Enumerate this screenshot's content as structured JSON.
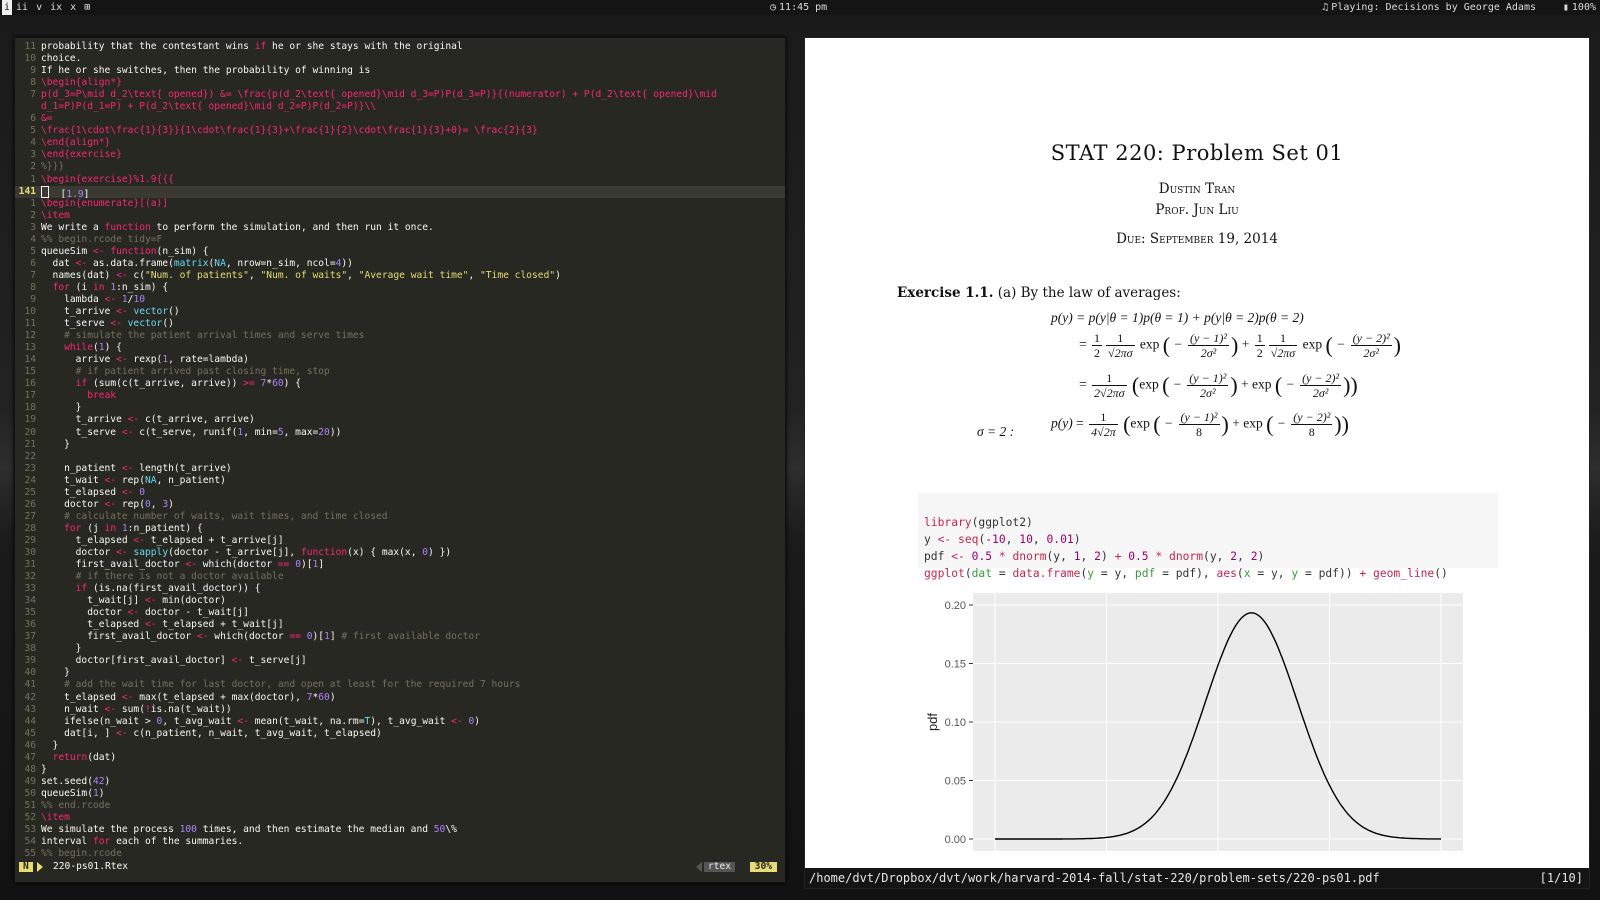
{
  "topbar": {
    "workspaces": [
      "i",
      "ii",
      "v",
      "ix",
      "x",
      "⊞"
    ],
    "active_workspace": 0,
    "time": "11:45 pm",
    "now_playing": "Playing: Decisions by George Adams",
    "battery": "100%"
  },
  "editor": {
    "lines": [
      {
        "n": "11",
        "t": "probability that the contestant wins if he or she stays with the original",
        "cls": ""
      },
      {
        "n": "10",
        "t": "choice.",
        "cls": ""
      },
      {
        "n": "9",
        "t": "If he or she switches, then the probability of winning is",
        "cls": ""
      },
      {
        "n": "8",
        "t": "\\begin{align*}",
        "cls": "k"
      },
      {
        "n": "7",
        "t": "p(d_3=P\\mid d_2\\text{ opened}) &= \\frac{p(d_2\\text{ opened}\\mid d_3=P)P(d_3=P)}{(numerator) + P(d_2\\text{ opened}\\mid",
        "cls": "k"
      },
      {
        "n": "",
        "t": "d_1=P)P(d_1=P) + P(d_2\\text{ opened}\\mid d_2=P)P(d_2=P)}\\\\",
        "cls": "k"
      },
      {
        "n": "6",
        "t": "&=",
        "cls": "k"
      },
      {
        "n": "5",
        "t": "\\frac{1\\cdot\\frac{1}{3}}{1\\cdot\\frac{1}{3}+\\frac{1}{2}\\cdot\\frac{1}{3}+0}= \\frac{2}{3}",
        "cls": "k"
      },
      {
        "n": "4",
        "t": "\\end{align*}",
        "cls": "k"
      },
      {
        "n": "3",
        "t": "\\end{exercise}",
        "cls": "k"
      },
      {
        "n": "2",
        "t": "%}}}",
        "cls": "c"
      },
      {
        "n": "1",
        "t": "\\begin{exercise}%1.9{{{",
        "cls": "k"
      },
      {
        "n": "141",
        "t": "  [1.9]",
        "cls": "",
        "cur": true
      },
      {
        "n": "1",
        "t": "\\begin{enumerate}[(a)]",
        "cls": "k"
      },
      {
        "n": "2",
        "t": "\\item",
        "cls": "k"
      },
      {
        "n": "3",
        "t": "We write a function to perform the simulation, and then run it once.",
        "cls": ""
      },
      {
        "n": "4",
        "t": "%% begin.rcode tidy=F",
        "cls": "c"
      },
      {
        "n": "5",
        "t": "queueSim <- function(n_sim) {",
        "cls": ""
      },
      {
        "n": "6",
        "t": "  dat <- as.data.frame(matrix(NA, nrow=n_sim, ncol=4))",
        "cls": ""
      },
      {
        "n": "7",
        "t": "  names(dat) <- c(\"Num. of patients\", \"Num. of waits\", \"Average wait time\", \"Time closed\")",
        "cls": ""
      },
      {
        "n": "8",
        "t": "  for (i in 1:n_sim) {",
        "cls": ""
      },
      {
        "n": "9",
        "t": "    lambda <- 1/10",
        "cls": ""
      },
      {
        "n": "10",
        "t": "    t_arrive <- vector()",
        "cls": ""
      },
      {
        "n": "11",
        "t": "    t_serve <- vector()",
        "cls": ""
      },
      {
        "n": "12",
        "t": "    # simulate the patient arrival times and serve times",
        "cls": "c"
      },
      {
        "n": "13",
        "t": "    while(1) {",
        "cls": ""
      },
      {
        "n": "14",
        "t": "      arrive <- rexp(1, rate=lambda)",
        "cls": ""
      },
      {
        "n": "15",
        "t": "      # if patient arrived past closing time, stop",
        "cls": "c"
      },
      {
        "n": "16",
        "t": "      if (sum(c(t_arrive, arrive)) >= 7*60) {",
        "cls": ""
      },
      {
        "n": "17",
        "t": "        break",
        "cls": "k"
      },
      {
        "n": "18",
        "t": "      }",
        "cls": ""
      },
      {
        "n": "19",
        "t": "      t_arrive <- c(t_arrive, arrive)",
        "cls": ""
      },
      {
        "n": "20",
        "t": "      t_serve <- c(t_serve, runif(1, min=5, max=20))",
        "cls": ""
      },
      {
        "n": "21",
        "t": "    }",
        "cls": ""
      },
      {
        "n": "22",
        "t": "",
        "cls": ""
      },
      {
        "n": "23",
        "t": "    n_patient <- length(t_arrive)",
        "cls": ""
      },
      {
        "n": "24",
        "t": "    t_wait <- rep(NA, n_patient)",
        "cls": ""
      },
      {
        "n": "25",
        "t": "    t_elapsed <- 0",
        "cls": ""
      },
      {
        "n": "26",
        "t": "    doctor <- rep(0, 3)",
        "cls": ""
      },
      {
        "n": "27",
        "t": "    # calculate number of waits, wait times, and time closed",
        "cls": "c"
      },
      {
        "n": "28",
        "t": "    for (j in 1:n_patient) {",
        "cls": ""
      },
      {
        "n": "29",
        "t": "      t_elapsed <- t_elapsed + t_arrive[j]",
        "cls": ""
      },
      {
        "n": "30",
        "t": "      doctor <- sapply(doctor - t_arrive[j], function(x) { max(x, 0) })",
        "cls": ""
      },
      {
        "n": "31",
        "t": "      first_avail_doctor <- which(doctor == 0)[1]",
        "cls": ""
      },
      {
        "n": "32",
        "t": "      # if there is not a doctor available",
        "cls": "c"
      },
      {
        "n": "33",
        "t": "      if (is.na(first_avail_doctor)) {",
        "cls": ""
      },
      {
        "n": "34",
        "t": "        t_wait[j] <- min(doctor)",
        "cls": ""
      },
      {
        "n": "35",
        "t": "        doctor <- doctor - t_wait[j]",
        "cls": ""
      },
      {
        "n": "36",
        "t": "        t_elapsed <- t_elapsed + t_wait[j]",
        "cls": ""
      },
      {
        "n": "37",
        "t": "        first_avail_doctor <- which(doctor == 0)[1] # first available doctor",
        "cls": ""
      },
      {
        "n": "38",
        "t": "      }",
        "cls": ""
      },
      {
        "n": "39",
        "t": "      doctor[first_avail_doctor] <- t_serve[j]",
        "cls": ""
      },
      {
        "n": "40",
        "t": "    }",
        "cls": ""
      },
      {
        "n": "41",
        "t": "    # add the wait time for last doctor, and open at least for the required 7 hours",
        "cls": "c"
      },
      {
        "n": "42",
        "t": "    t_elapsed <- max(t_elapsed + max(doctor), 7*60)",
        "cls": ""
      },
      {
        "n": "43",
        "t": "    n_wait <- sum(!is.na(t_wait))",
        "cls": ""
      },
      {
        "n": "44",
        "t": "    ifelse(n_wait > 0, t_avg_wait <- mean(t_wait, na.rm=T), t_avg_wait <- 0)",
        "cls": ""
      },
      {
        "n": "45",
        "t": "    dat[i, ] <- c(n_patient, n_wait, t_avg_wait, t_elapsed)",
        "cls": ""
      },
      {
        "n": "46",
        "t": "  }",
        "cls": ""
      },
      {
        "n": "47",
        "t": "  return(dat)",
        "cls": ""
      },
      {
        "n": "48",
        "t": "}",
        "cls": ""
      },
      {
        "n": "49",
        "t": "set.seed(42)",
        "cls": ""
      },
      {
        "n": "50",
        "t": "queueSim(1)",
        "cls": ""
      },
      {
        "n": "51",
        "t": "%% end.rcode",
        "cls": "c"
      },
      {
        "n": "52",
        "t": "\\item",
        "cls": "k"
      },
      {
        "n": "53",
        "t": "We simulate the process 100 times, and then estimate the median and 50\\%",
        "cls": ""
      },
      {
        "n": "54",
        "t": "interval for each of the summaries.",
        "cls": ""
      },
      {
        "n": "55",
        "t": "%% begin.rcode",
        "cls": "c"
      }
    ],
    "status": {
      "mode": "N",
      "filename": "220-ps01.Rtex",
      "filetype": "rtex",
      "percent": "30%"
    }
  },
  "viewer": {
    "title": "STAT 220: Problem Set 01",
    "author1": "Dustin Tran",
    "author2": "Prof. Jun Liu",
    "due": "Due: September 19, 2014",
    "exercise_label": "Exercise 1.1.",
    "exercise_text": "(a)  By the law of averages:",
    "sigma_label": "σ = 2 :",
    "rcode_lines": [
      "library(ggplot2)",
      "y <- seq(-10, 10, 0.01)",
      "pdf <- 0.5 * dnorm(y, 1, 2) + 0.5 * dnorm(y, 2, 2)",
      "ggplot(dat = data.frame(y = y, pdf = pdf), aes(x = y, y = pdf)) + geom_line()"
    ],
    "path": "/home/dvt/Dropbox/dvt/work/harvard-2014-fall/stat-220/problem-sets/220-ps01.pdf",
    "page_indicator": "[1/10]"
  },
  "chart_data": {
    "type": "line",
    "ylabel": "pdf",
    "ylim": [
      0,
      0.2
    ],
    "xlim": [
      -10,
      10
    ],
    "yticks": [
      "0.00",
      "0.05",
      "0.10",
      "0.15",
      "0.20"
    ],
    "series": [
      {
        "formula": "0.5*dnorm(y,1,2)+0.5*dnorm(y,2,2)"
      }
    ],
    "colors": {
      "panel_bg": "#ebebeb",
      "grid": "#ffffff",
      "line": "#000000"
    }
  }
}
